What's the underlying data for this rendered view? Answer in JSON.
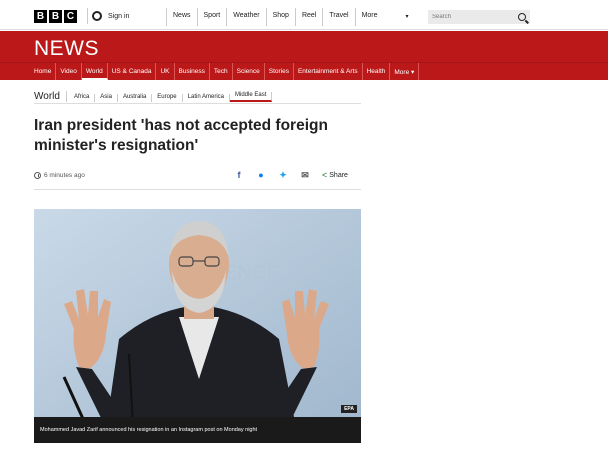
{
  "header": {
    "logo_letters": [
      "B",
      "B",
      "C"
    ],
    "signin_label": "Sign in",
    "nav": [
      "News",
      "Sport",
      "Weather",
      "Shop",
      "Reel",
      "Travel",
      "More"
    ],
    "search_placeholder": "Search"
  },
  "banner": {
    "title": "NEWS"
  },
  "sections": [
    "Home",
    "Video",
    "World",
    "US & Canada",
    "UK",
    "Business",
    "Tech",
    "Science",
    "Stories",
    "Entertainment & Arts",
    "Health",
    "More ▾"
  ],
  "subnav": {
    "current": "World",
    "items": [
      "Africa",
      "Asia",
      "Australia",
      "Europe",
      "Latin America",
      "Middle East"
    ]
  },
  "article": {
    "headline": "Iran president 'has not accepted foreign minister's resignation'",
    "timestamp": "6 minutes ago",
    "share_label": "Share",
    "image_caption": "Mohammed Javad Zarif announced his resignation in an Instagram post on Monday night",
    "image_credit": "EPA"
  },
  "colors": {
    "brand_red": "#bb1919"
  }
}
